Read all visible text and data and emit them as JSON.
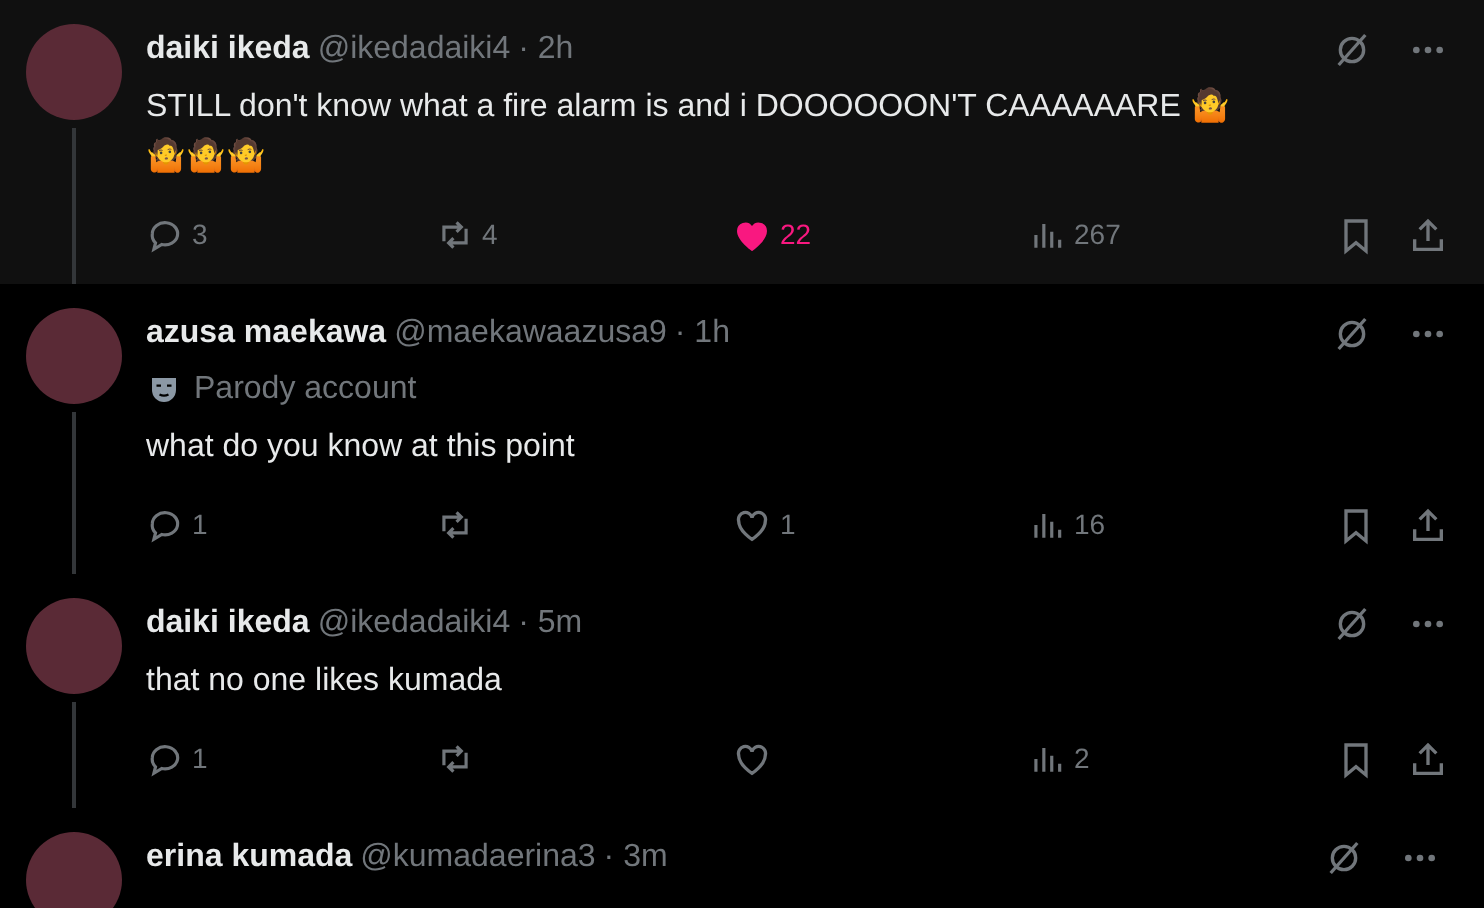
{
  "tweets": [
    {
      "name": "daiki ikeda",
      "handle": "@ikedadaiki4",
      "time": "· 2h",
      "selected": true,
      "thread_line": true,
      "text": "STILL don't know what a fire alarm is and i DOOOOOON'T CAAAAAARE 🤷 🤷🤷🤷",
      "replies": "3",
      "reposts": "4",
      "likes": "22",
      "liked": true,
      "views": "267"
    },
    {
      "name": "azusa maekawa",
      "handle": "@maekawaazusa9",
      "time": "· 1h",
      "selected": false,
      "thread_line": true,
      "badge": "Parody account",
      "text": "what do you know at this point",
      "replies": "1",
      "likes": "1",
      "liked": false,
      "views": "16"
    },
    {
      "name": "daiki ikeda",
      "handle": "@ikedadaiki4",
      "time": "· 5m",
      "selected": false,
      "thread_line": true,
      "text": "that no one likes kumada",
      "replies": "1",
      "liked": false,
      "views": "2"
    },
    {
      "name": "erina kumada",
      "handle": "@kumadaerina3",
      "time": "· 3m",
      "selected": false,
      "thread_line": false
    }
  ]
}
